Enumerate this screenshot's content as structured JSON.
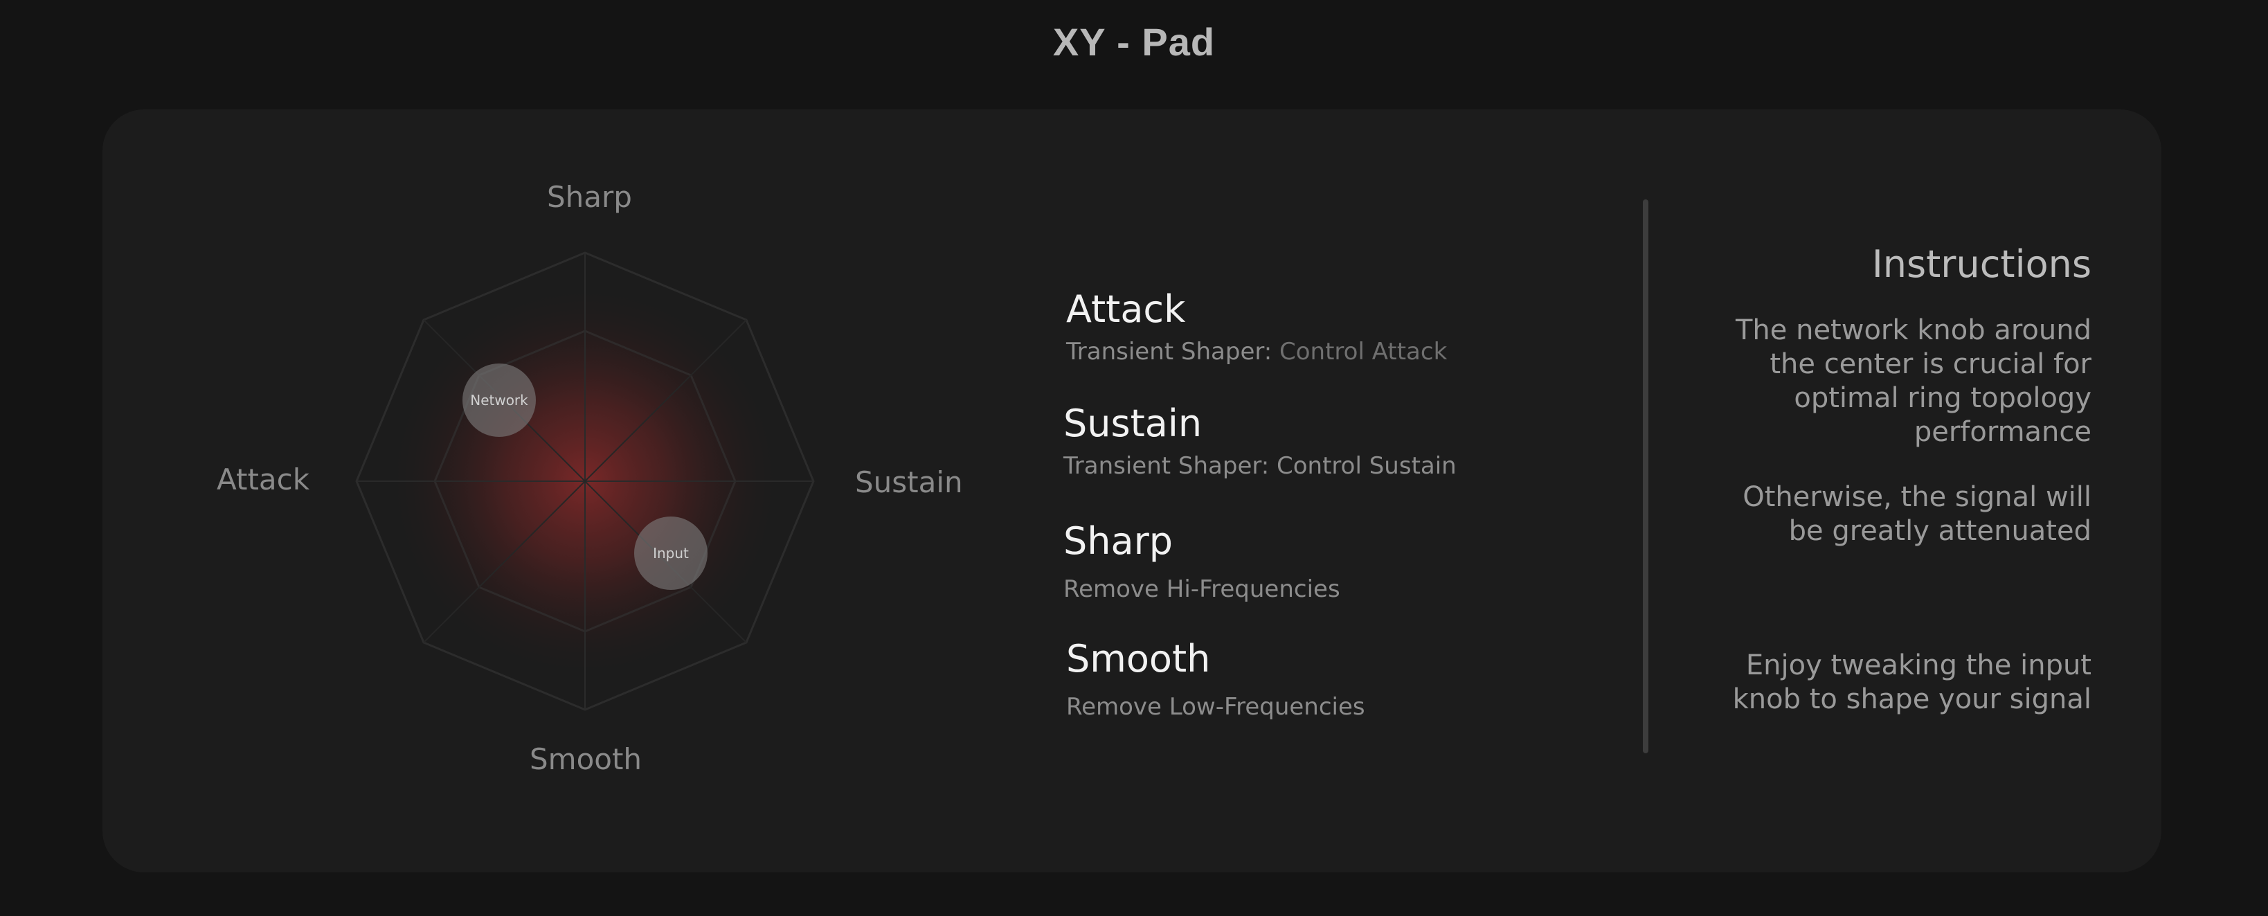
{
  "app": {
    "title": "XY - Pad"
  },
  "pad": {
    "axis_labels": {
      "top": "Sharp",
      "left": "Attack",
      "right": "Sustain",
      "bottom": "Smooth"
    },
    "knobs": {
      "network": "Network",
      "input": "Input"
    },
    "glow_color": "#8a2a2a"
  },
  "params": [
    {
      "name": "Attack",
      "desc_prefix": "Transient Shaper:",
      "desc_suffix": " Control Attack"
    },
    {
      "name": "Sustain",
      "desc_prefix": "Transient Shaper: Control Sustain",
      "desc_suffix": ""
    },
    {
      "name": "Sharp",
      "desc_prefix": "Remove Hi-Frequencies",
      "desc_suffix": ""
    },
    {
      "name": "Smooth",
      "desc_prefix": "Remove Low-Frequencies",
      "desc_suffix": ""
    }
  ],
  "instructions": {
    "title": "Instructions",
    "paragraphs": [
      "The network knob around\nthe center is crucial for\noptimal ring topology\nperformance",
      "Otherwise, the signal will\nbe greatly attenuated",
      "Enjoy tweaking the input\nknob to shape your signal"
    ]
  },
  "colors": {
    "background": "#141414",
    "panel": "#1c1c1c"
  }
}
